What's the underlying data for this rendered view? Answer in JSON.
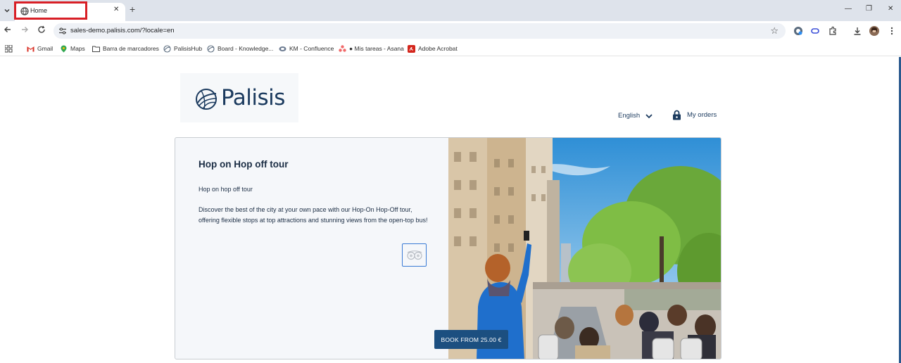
{
  "browser": {
    "tab": {
      "title": "Home",
      "close_glyph": "✕",
      "icon": "globe-icon"
    },
    "new_tab_glyph": "+",
    "window_controls": {
      "minimize": "—",
      "restore": "❐",
      "close": "✕"
    },
    "address_bar": {
      "url": "sales-demo.palisis.com/?locale=en"
    },
    "highlight_color": "#d81f26"
  },
  "bookmarks": [
    {
      "label": "Gmail",
      "icon": "gmail-icon"
    },
    {
      "label": "Maps",
      "icon": "maps-icon"
    },
    {
      "label": "Barra de marcadores",
      "icon": "folder-icon"
    },
    {
      "label": "PalisisHub",
      "icon": "palisis-icon"
    },
    {
      "label": "Board - Knowledge...",
      "icon": "palisis-icon"
    },
    {
      "label": "KM - Confluence",
      "icon": "confluence-icon"
    },
    {
      "label": "● Mis tareas - Asana",
      "icon": "asana-icon"
    },
    {
      "label": "Adobe Acrobat",
      "icon": "acrobat-icon"
    }
  ],
  "site": {
    "brand": "Palisis",
    "language": "English",
    "my_orders": "My orders",
    "brand_color": "#1b3a5e",
    "accent_color": "#1c4f80"
  },
  "product": {
    "title": "Hop on Hop off tour",
    "subtitle": "Hop on hop off tour",
    "description": "Discover the best of the city at your own pace with our Hop-On Hop-Off tour, offering flexible stops at top attractions and stunning views from the open-top bus!",
    "book_label": "BOOK FROM 25.00 €"
  }
}
